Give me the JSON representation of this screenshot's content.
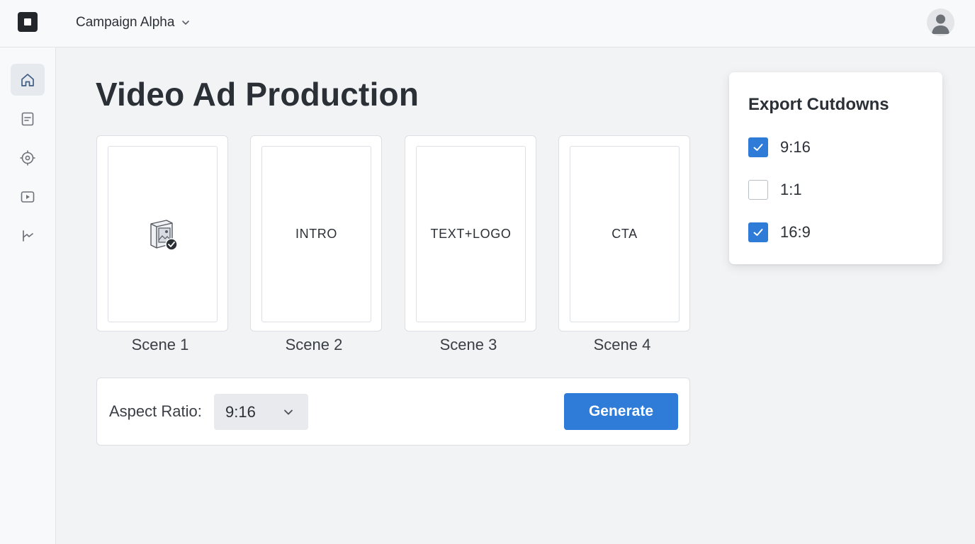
{
  "topbar": {
    "campaign_name": "Campaign Alpha",
    "logo_icon": "app-logo-icon",
    "chevron_icon": "chevron-down-icon",
    "avatar_icon": "user-avatar-icon"
  },
  "sidebar": {
    "items": [
      {
        "icon": "home-icon",
        "active": true
      },
      {
        "icon": "document-icon",
        "active": false
      },
      {
        "icon": "target-icon",
        "active": false
      },
      {
        "icon": "play-video-icon",
        "active": false
      },
      {
        "icon": "analytics-icon",
        "active": false
      }
    ]
  },
  "main": {
    "title": "Video Ad Production",
    "scenes": [
      {
        "label": "Scene 1",
        "content": "",
        "icon": "media-check-icon"
      },
      {
        "label": "Scene 2",
        "content": "INTRO"
      },
      {
        "label": "Scene 3",
        "content": "TEXT+LOGO"
      },
      {
        "label": "Scene 4",
        "content": "CTA"
      }
    ],
    "aspect_ratio": {
      "label": "Aspect Ratio:",
      "selected": "9:16"
    },
    "generate_label": "Generate"
  },
  "export": {
    "title": "Export Cutdowns",
    "options": [
      {
        "label": "9:16",
        "checked": true
      },
      {
        "label": "1:1",
        "checked": false
      },
      {
        "label": "16:9",
        "checked": true
      }
    ]
  },
  "colors": {
    "accent": "#2f7bd8",
    "background": "#f2f3f5",
    "text": "#2b2f36"
  }
}
